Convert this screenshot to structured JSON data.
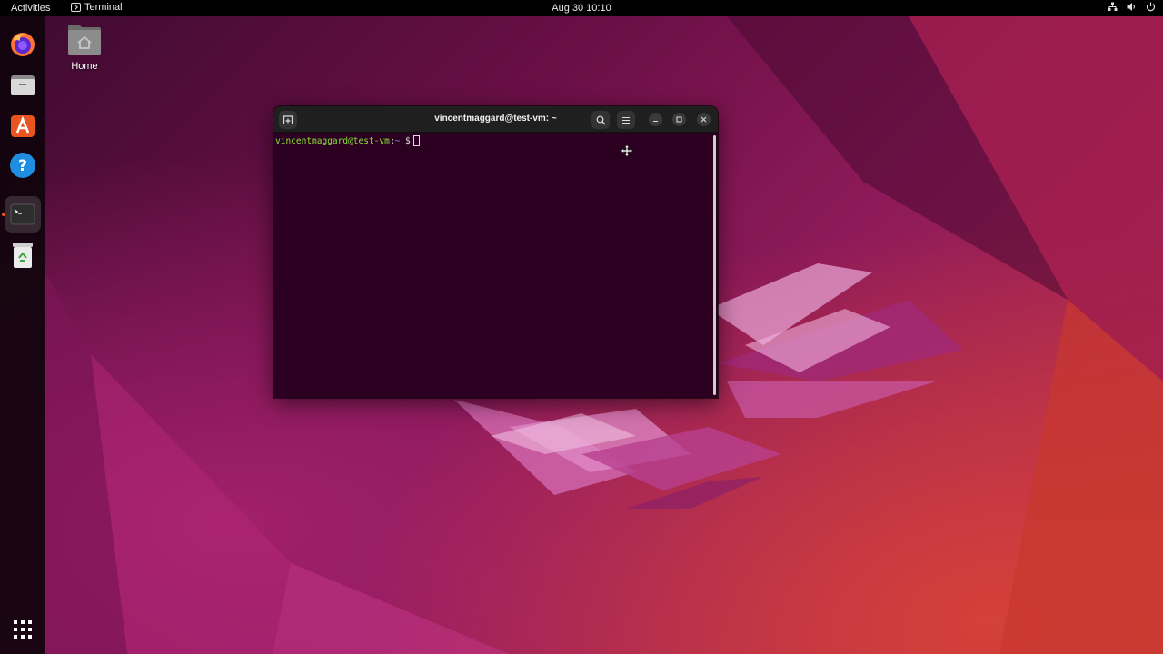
{
  "topbar": {
    "activities_label": "Activities",
    "app_name": "Terminal",
    "clock": "Aug 30  10:10",
    "status_icons": [
      "network-icon",
      "volume-icon",
      "power-icon"
    ]
  },
  "dock": {
    "apps": [
      {
        "name": "Firefox",
        "icon": "firefox-icon"
      },
      {
        "name": "Files",
        "icon": "files-icon"
      },
      {
        "name": "Ubuntu Software",
        "icon": "software-icon"
      },
      {
        "name": "Help",
        "icon": "help-icon"
      },
      {
        "name": "Terminal",
        "icon": "terminal-icon",
        "running": true,
        "active": true
      },
      {
        "name": "Trash",
        "icon": "trash-icon"
      }
    ],
    "show_apps_icon": "app-grid-icon"
  },
  "desktop": {
    "home_label": "Home"
  },
  "terminal": {
    "title": "vincentmaggard@test-vm: ~",
    "prompt_user": "vincentmaggard@test-vm",
    "prompt_colon": ":",
    "prompt_path": "~",
    "prompt_dollar": "$",
    "input_value": ""
  },
  "colors": {
    "accent": "#e95420",
    "terminal_bg": "#2c0020",
    "prompt_user": "#8ae234",
    "prompt_path": "#729fcf"
  }
}
